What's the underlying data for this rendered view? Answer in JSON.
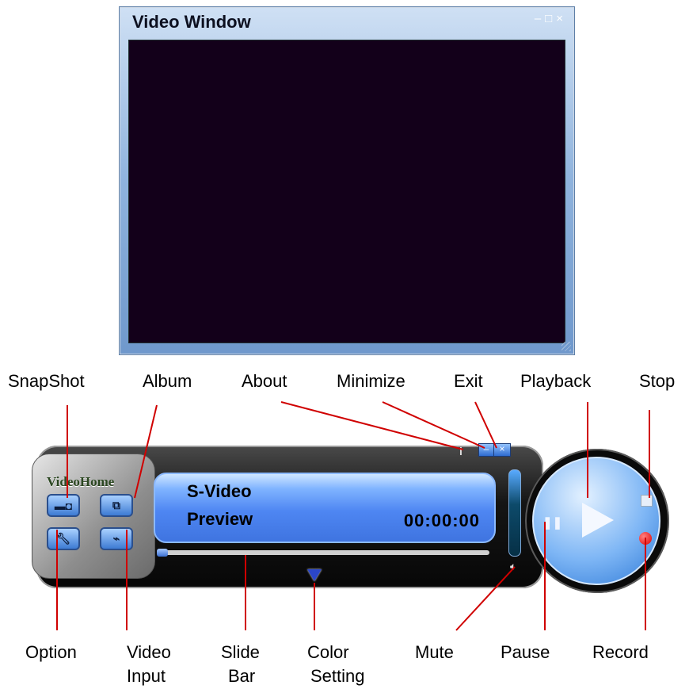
{
  "video_window": {
    "title": "Video Window",
    "controls": {
      "minimize": "–",
      "maximize": "□",
      "close": "×"
    }
  },
  "player": {
    "logo": "VideoHome",
    "display": {
      "source": "S-Video",
      "mode": "Preview",
      "time": "00:00:00"
    },
    "slide_bar": {
      "position": 0
    }
  },
  "labels": {
    "snapshot": "SnapShot",
    "album": "Album",
    "about": "About",
    "minimize": "Minimize",
    "exit": "Exit",
    "playback": "Playback",
    "stop": "Stop",
    "option": "Option",
    "video_input_1": "Video",
    "video_input_2": "Input",
    "slide_bar_1": "Slide",
    "slide_bar_2": "Bar",
    "color_setting_1": "Color",
    "color_setting_2": "Setting",
    "mute": "Mute",
    "pause": "Pause",
    "record": "Record"
  },
  "icons": {
    "snapshot": "camera-icon",
    "album": "album-icon",
    "option": "wrench-icon",
    "video_input": "cable-icon",
    "about": "info-icon",
    "mute": "speaker-icon",
    "playback": "play-icon",
    "pause": "pause-icon",
    "stop": "stop-icon",
    "record": "record-icon"
  },
  "colors": {
    "screen": "#13001a",
    "display": "#4e86f2",
    "leader_lines": "#d00000"
  }
}
